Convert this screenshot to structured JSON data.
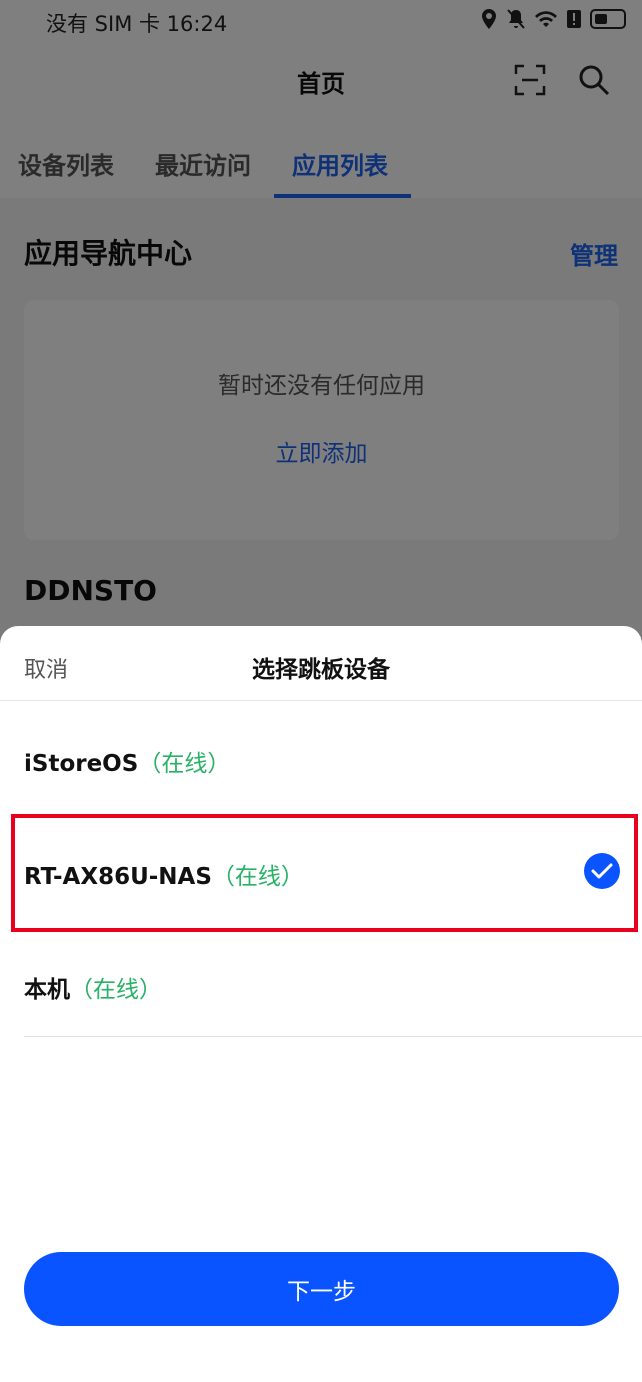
{
  "status_bar": {
    "carrier_time": "没有 SIM 卡 16:24",
    "icons": [
      "location-icon",
      "mute-icon",
      "wifi-icon",
      "alert-icon",
      "battery-icon"
    ]
  },
  "header": {
    "title": "首页",
    "icons": [
      "scan-icon",
      "search-icon"
    ]
  },
  "tabs": [
    {
      "label": "设备列表",
      "active": false
    },
    {
      "label": "最近访问",
      "active": false
    },
    {
      "label": "应用列表",
      "active": true
    }
  ],
  "app_nav": {
    "title": "应用导航中心",
    "manage_label": "管理",
    "empty_text": "暂时还没有任何应用",
    "add_label": "立即添加"
  },
  "ddnsto_title": "DDNSTO",
  "sheet": {
    "cancel_label": "取消",
    "title": "选择跳板设备",
    "devices": [
      {
        "name": "iStoreOS",
        "status": "（在线）",
        "selected": false
      },
      {
        "name": "RT-AX86U-NAS",
        "status": "（在线）",
        "selected": true
      },
      {
        "name": "本机",
        "status": "（在线）",
        "selected": false
      }
    ],
    "next_label": "下一步"
  },
  "colors": {
    "accent": "#1c63f0",
    "button": "#0a54ff",
    "online": "#27b266",
    "highlight": "#e8001c"
  }
}
